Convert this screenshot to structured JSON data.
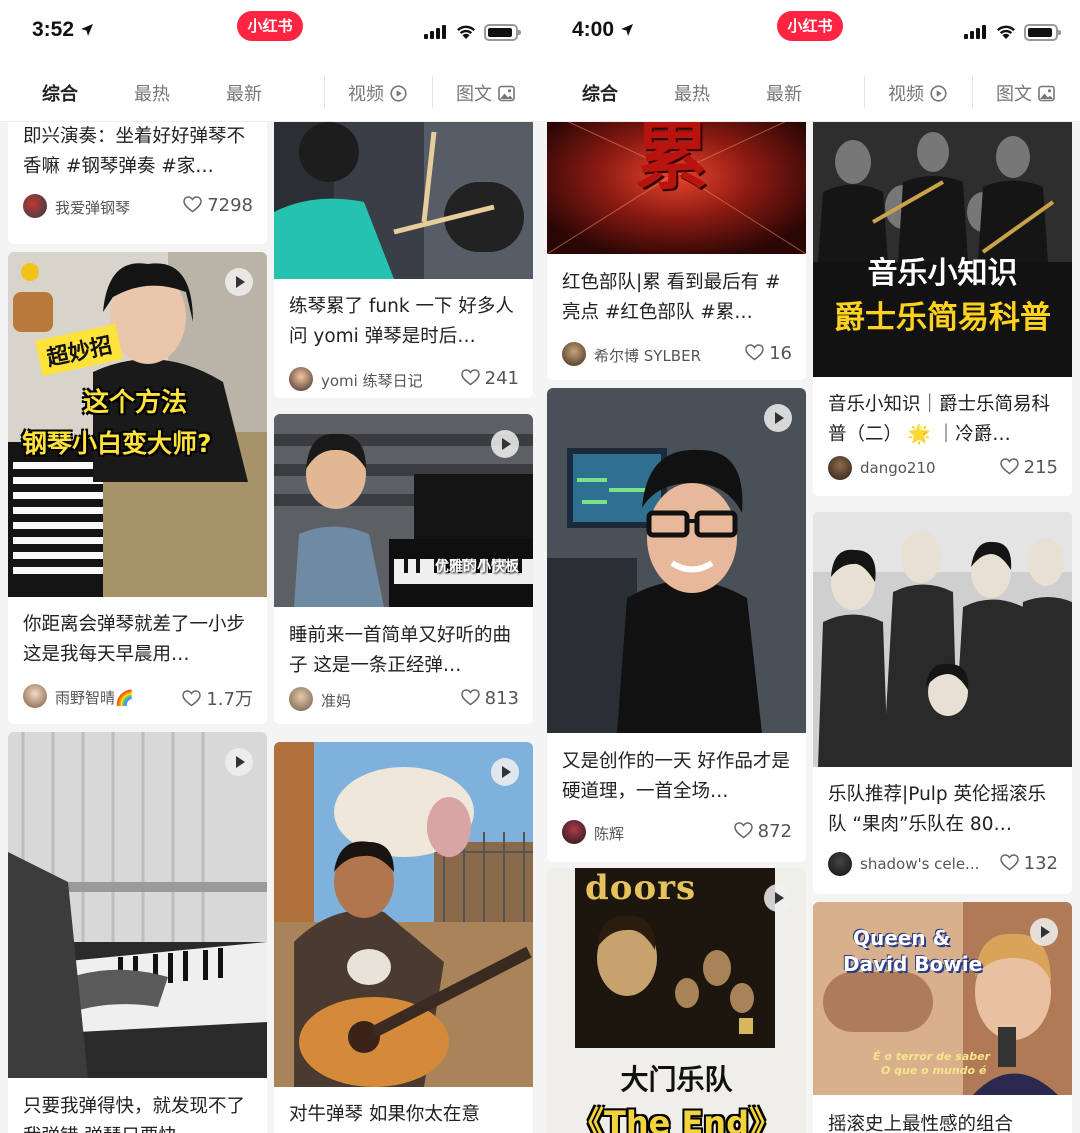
{
  "screens": [
    {
      "time": "3:52",
      "logo": "小红书",
      "tabs": [
        "综合",
        "最热",
        "最新",
        "视频",
        "图文"
      ],
      "cards": [
        {
          "title": "即兴演奏：坐着好好弹琴不香嘛 #钢琴弹奏 #家…",
          "author": "我爱弹钢琴",
          "likes": "7298"
        },
        {
          "title": "练琴累了 funk 一下 好多人问 yomi 弹琴是时后…",
          "author": "yomi 练琴日记",
          "likes": "241"
        },
        {
          "title": "你距离会弹琴就差了一小步 这是我每天早晨用…",
          "author": "雨野智晴🌈",
          "likes": "1.7万",
          "overlay": [
            "超妙招",
            "这个方法",
            "钢琴小白变大师?"
          ]
        },
        {
          "title": "睡前来一首简单又好听的曲子 这是一条正经弹…",
          "author": "准妈",
          "likes": "813",
          "overlay": [
            "优雅的小快板"
          ]
        },
        {
          "title": "只要我弹得快，就发现不了我弹错 弹琴只要快",
          "author": "",
          "likes": ""
        },
        {
          "title": "对牛弹琴 如果你太在意",
          "author": "",
          "likes": ""
        }
      ]
    },
    {
      "time": "4:00",
      "logo": "小红书",
      "tabs": [
        "综合",
        "最热",
        "最新",
        "视频",
        "图文"
      ],
      "cards": [
        {
          "title": "红色部队|累 看到最后有 #亮点 #红色部队 #累…",
          "author": "希尔博 SYLBER",
          "likes": "16",
          "overlay": [
            "累"
          ]
        },
        {
          "title": "音乐小知识｜爵士乐简易科普（二） 🌟 ｜冷爵…",
          "author": "dango210",
          "likes": "215",
          "overlay": [
            "音乐小知识",
            "爵士乐简易科普"
          ]
        },
        {
          "title": "又是创作的一天 好作品才是硬道理，一首全场…",
          "author": "陈辉",
          "likes": "872"
        },
        {
          "title": "乐队推荐|Pulp 英伦摇滚乐队 “果肉”乐队在 80…",
          "author": "shadow's cele...",
          "likes": "132"
        },
        {
          "title": "",
          "author": "",
          "likes": "",
          "overlay": [
            "doors",
            "大门乐队",
            "《The End》"
          ]
        },
        {
          "title": "摇滚史上最性感的组合",
          "author": "",
          "likes": "",
          "overlay": [
            "Queen &",
            "David Bowie",
            "É o terror de saber",
            "O que o mundo é"
          ]
        }
      ]
    }
  ]
}
